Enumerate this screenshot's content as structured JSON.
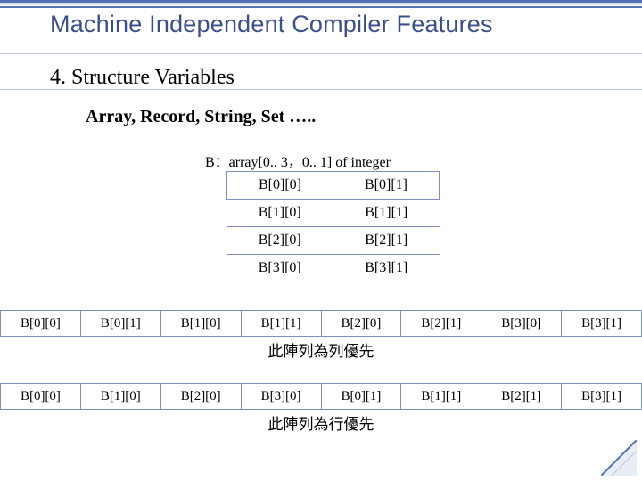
{
  "title": "Machine Independent Compiler Features",
  "section_number": "4.",
  "section_label": "Structure Variables",
  "sub2": "Array, Record, String, Set …..",
  "decl": "B：array[0.. 3，0.. 1] of integer",
  "matrix": {
    "r0": {
      "c0": "B[0][0]",
      "c1": "B[0][1]"
    },
    "r1": {
      "c0": "B[1][0]",
      "c1": "B[1][1]"
    },
    "r2": {
      "c0": "B[2][0]",
      "c1": "B[2][1]"
    },
    "r3": {
      "c0": "B[3][0]",
      "c1": "B[3][1]"
    }
  },
  "seq_row": {
    "c0": "B[0][0]",
    "c1": "B[0][1]",
    "c2": "B[1][0]",
    "c3": "B[1][1]",
    "c4": "B[2][0]",
    "c5": "B[2][1]",
    "c6": "B[3][0]",
    "c7": "B[3][1]",
    "caption": "此陣列為列優先"
  },
  "seq_col": {
    "c0": "B[0][0]",
    "c1": "B[1][0]",
    "c2": "B[2][0]",
    "c3": "B[3][0]",
    "c4": "B[0][1]",
    "c5": "B[1][1]",
    "c6": "B[2][1]",
    "c7": "B[3][1]",
    "caption": "此陣列為行優先"
  }
}
